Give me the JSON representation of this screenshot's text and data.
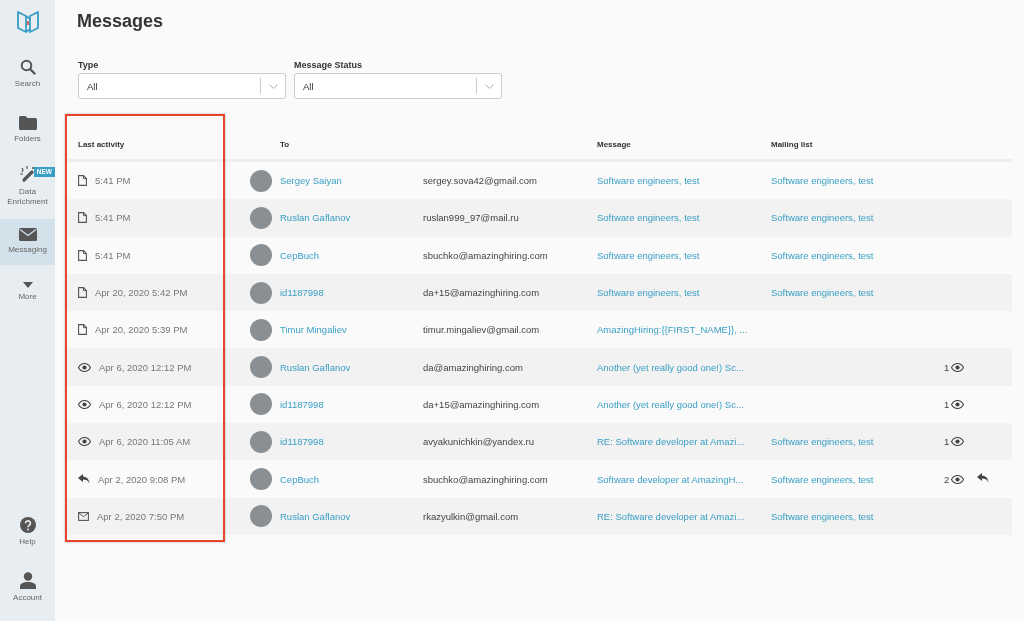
{
  "sidebar": {
    "items": [
      {
        "kind": "search",
        "label": "Search",
        "selected": false
      },
      {
        "kind": "folder",
        "label": "Folders",
        "selected": false
      },
      {
        "kind": "wand",
        "label": "Data Enrichment",
        "badge": "NEW",
        "selected": false
      },
      {
        "kind": "mail",
        "label": "Messaging",
        "selected": true
      },
      {
        "kind": "more",
        "label": "More",
        "selected": false
      }
    ],
    "bottom_items": [
      {
        "kind": "help",
        "label": "Help"
      },
      {
        "kind": "account",
        "label": "Account"
      }
    ]
  },
  "title": "Messages",
  "filters": [
    {
      "label": "Type",
      "value": "All"
    },
    {
      "label": "Message Status",
      "value": "All"
    }
  ],
  "table": {
    "columns": [
      {
        "label": "Last activity",
        "highlighted": true
      },
      {
        "label": "To",
        "highlighted": false
      },
      {
        "label": "Message",
        "highlighted": false
      },
      {
        "label": "Mailing list",
        "highlighted": false
      }
    ],
    "rows": [
      {
        "kind": "draft",
        "time": "5:41 PM",
        "name": "Sergey Saiyan",
        "email": "sergey.sova42@gmail.com",
        "message": "Software engineers, test",
        "mailing_list": "Software engineers, test",
        "replied": false
      },
      {
        "kind": "draft",
        "time": "5:41 PM",
        "name": "Ruslan Gaflanov",
        "email": "ruslan999_97@mail.ru",
        "message": "Software engineers, test",
        "mailing_list": "Software engineers, test",
        "replied": false
      },
      {
        "kind": "draft",
        "time": "5:41 PM",
        "name": "CepBuch",
        "email": "sbuchko@amazinghiring.com",
        "message": "Software engineers, test",
        "mailing_list": "Software engineers, test",
        "replied": false
      },
      {
        "kind": "draft",
        "time": "Apr 20, 2020 5:42 PM",
        "name": "id1187998",
        "email": "da+15@amazinghiring.com",
        "message": "Software engineers, test",
        "mailing_list": "Software engineers, test",
        "replied": false
      },
      {
        "kind": "draft",
        "time": "Apr 20, 2020 5:39 PM",
        "name": "Timur Mingaliev",
        "email": "timur.mingaliev@gmail.com",
        "message": "AmazingHiring:{{FIRST_NAME}}, ...",
        "replied": false
      },
      {
        "kind": "viewed",
        "time": "Apr 6, 2020 12:12 PM",
        "name": "Ruslan Gaflanov",
        "email": "da@amazinghiring.com",
        "message": "Another (yet really good one!) Sc...",
        "views": "1",
        "replied": false
      },
      {
        "kind": "viewed",
        "time": "Apr 6, 2020 12:12 PM",
        "name": "id1187998",
        "email": "da+15@amazinghiring.com",
        "message": "Another (yet really good one!) Sc...",
        "views": "1",
        "replied": false
      },
      {
        "kind": "viewed",
        "time": "Apr 6, 2020 11:05 AM",
        "name": "id1187998",
        "email": "avyakunichkin@yandex.ru",
        "message": "RE: Software developer at Amazi...",
        "mailing_list": "Software engineers, test",
        "views": "1",
        "replied": false
      },
      {
        "kind": "replied",
        "time": "Apr 2, 2020 9:08 PM",
        "name": "CepBuch",
        "email": "sbuchko@amazinghiring.com",
        "message": "Software developer at AmazingH...",
        "mailing_list": "Software engineers, test",
        "views": "2",
        "replied": true
      },
      {
        "kind": "sent",
        "time": "Apr 2, 2020 7:50 PM",
        "name": "Ruslan Gaflanov",
        "email": "rkazyulkin@gmail.com",
        "message": "RE: Software developer at Amazi...",
        "mailing_list": "Software engineers, test",
        "replied": false
      }
    ]
  }
}
